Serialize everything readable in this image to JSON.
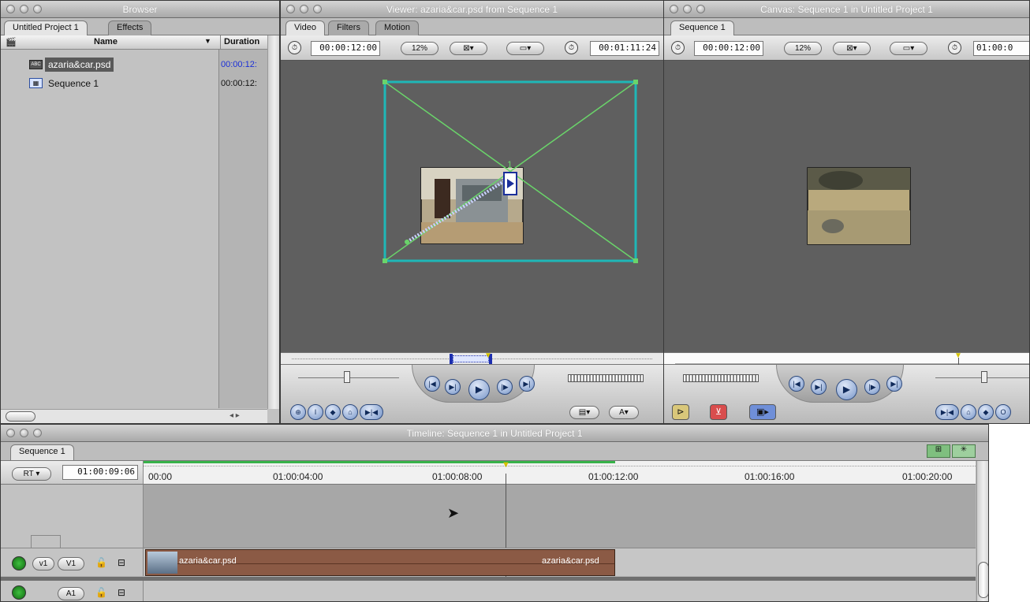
{
  "browser": {
    "title": "Browser",
    "tabs": [
      "Untitled Project 1",
      "Effects"
    ],
    "columns": {
      "name": "Name",
      "duration": "Duration"
    },
    "items": [
      {
        "icon": "psd-file-icon",
        "name": "azaria&car.psd",
        "duration": "00:00:12:",
        "selected": true
      },
      {
        "icon": "sequence-icon",
        "name": "Sequence 1",
        "duration": "00:00:12:",
        "selected": false
      }
    ]
  },
  "viewer": {
    "title": "Viewer: azaria&car.psd from Sequence 1",
    "tabs": [
      "Video",
      "Filters",
      "Motion"
    ],
    "duration_tc": "00:00:12:00",
    "zoom": "12%",
    "current_tc": "00:01:11:24",
    "keyframe_number": "1"
  },
  "canvas": {
    "title": "Canvas: Sequence 1 in Untitled Project 1",
    "tab": "Sequence 1",
    "duration_tc": "00:00:12:00",
    "zoom": "12%",
    "current_tc": "01:00:0"
  },
  "timeline": {
    "title": "Timeline: Sequence 1 in Untitled Project 1",
    "tab": "Sequence 1",
    "rt_label": "RT",
    "current_tc": "01:00:09:06",
    "ruler": [
      "00:00",
      "01:00:04:00",
      "01:00:08:00",
      "01:00:12:00",
      "01:00:16:00",
      "01:00:20:00"
    ],
    "video_track": {
      "source": "v1",
      "dest": "V1",
      "clip_label_1": "azaria&car.psd",
      "clip_label_2": "azaria&car.psd"
    },
    "audio_track": {
      "dest": "A1"
    },
    "colors": {
      "clip": "#8b5a45",
      "render_bar": "#38b24a",
      "motion_box": "#20b0b0",
      "path": "#6fd46f"
    }
  }
}
